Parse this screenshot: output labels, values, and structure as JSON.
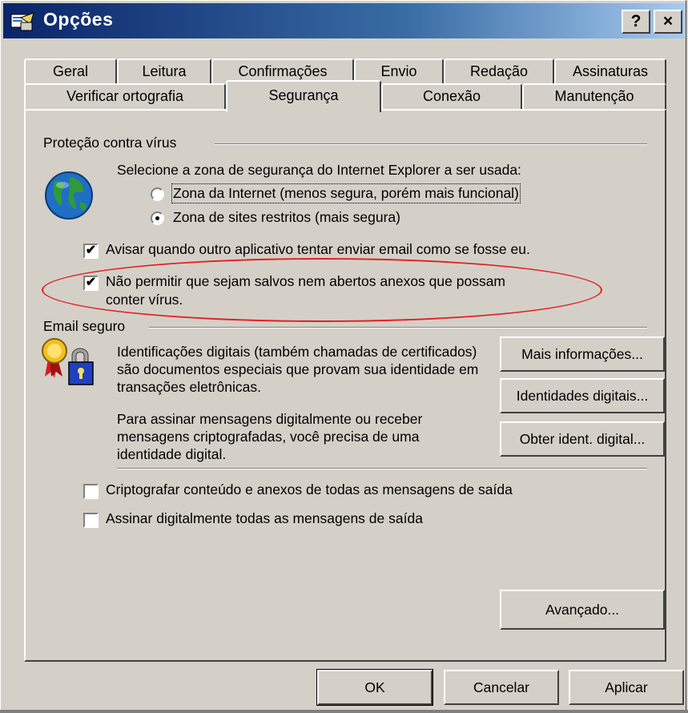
{
  "window": {
    "title": "Opções",
    "help_button": "?",
    "close_button": "×"
  },
  "tabs_row1": [
    "Geral",
    "Leitura",
    "Confirmações",
    "Envio",
    "Redação",
    "Assinaturas"
  ],
  "tabs_row2": [
    "Verificar ortografia",
    "Segurança",
    "Conexão",
    "Manutenção"
  ],
  "active_tab": "Segurança",
  "virus": {
    "group_label": "Proteção contra vírus",
    "zone_prompt": "Selecione a zona de segurança do Internet Explorer a ser usada:",
    "zone_internet": "Zona da Internet (menos segura, porém mais funcional)",
    "zone_restricted": "Zona de sites restritos (mais segura)",
    "warn_label": "Avisar quando outro aplicativo tentar enviar email como se fosse eu.",
    "block_label_line1": "Não permitir que sejam salvos nem abertos anexos que possam",
    "block_label_line2": "conter vírus."
  },
  "secure_mail": {
    "group_label": "Email seguro",
    "desc_1": "Identificações digitais (também chamadas de certificados) são documentos especiais que provam sua identidade em transações eletrônicas.",
    "desc_2": "Para assinar mensagens digitalmente ou receber mensagens criptografadas, você precisa de uma identidade digital.",
    "more_info_button": "Mais informações...",
    "digital_ids_button": "Identidades digitais...",
    "get_id_button": "Obter ident. digital...",
    "encrypt_label": "Criptografar conteúdo e anexos de todas as mensagens de saída",
    "sign_label": "Assinar digitalmente todas as mensagens de saída",
    "advanced_button": "Avançado..."
  },
  "footer": {
    "ok_button": "OK",
    "cancel_button": "Cancelar",
    "apply_button": "Aplicar"
  },
  "state": {
    "zone_selected": "restricted",
    "warn_checked": true,
    "block_checked": true,
    "encrypt_checked": false,
    "sign_checked": false,
    "check_mark": "✔"
  },
  "colors": {
    "titlebar_start": "#0a246a",
    "titlebar_end": "#a6caf0",
    "face": "#d4d0c8",
    "annotation": "#e02020"
  },
  "icons": [
    "options-window-icon",
    "globe-icon",
    "certificate-lock-icon"
  ]
}
